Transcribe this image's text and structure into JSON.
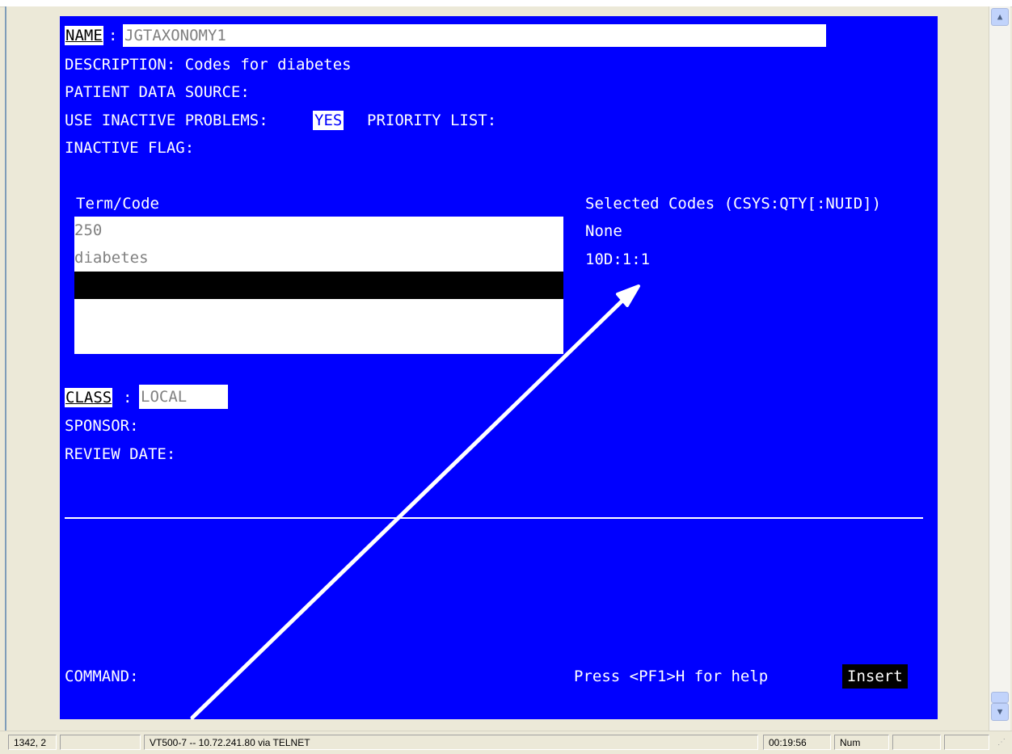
{
  "terminal": {
    "name_label": "NAME",
    "name_colon": ":",
    "name_value": "JGTAXONOMY1",
    "description": "DESCRIPTION: Codes for diabetes",
    "patient_data_source": "PATIENT DATA SOURCE:",
    "use_inactive_label": "USE INACTIVE PROBLEMS:",
    "use_inactive_value": "YES",
    "priority_list_label": "PRIORITY LIST:",
    "inactive_flag": "INACTIVE FLAG:",
    "term_code_header": "Term/Code",
    "term_rows": [
      "250",
      "diabetes",
      "",
      ""
    ],
    "selected_codes_header": "Selected Codes (CSYS:QTY[:NUID])",
    "selected_codes": [
      "None",
      "10D:1:1"
    ],
    "class_label": "CLASS",
    "class_colon": ":",
    "class_value": "LOCAL",
    "sponsor": "SPONSOR:",
    "review_date": "REVIEW DATE:",
    "command": "COMMAND:",
    "help_text": "Press <PF1>H for help",
    "insert_mode": "Insert"
  },
  "statusbar": {
    "cursor_pos": "1342, 2",
    "empty1": "",
    "connection": "VT500-7 -- 10.72.241.80 via TELNET",
    "clock": "00:19:56",
    "num": "Num",
    "empty2": "",
    "empty3": ""
  },
  "scrollbar": {
    "up_icon": "up-arrow-icon",
    "down_icon": "down-arrow-icon"
  },
  "colors": {
    "terminal_bg": "#0000ff",
    "text": "#ffffff",
    "field_text": "#808080",
    "selection": "#000000"
  }
}
